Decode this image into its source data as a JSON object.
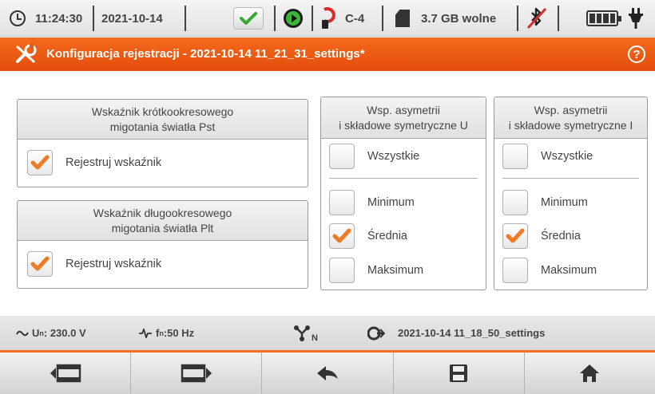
{
  "status": {
    "time": "11:24:30",
    "date": "2021-10-14",
    "clamp": "C-4",
    "storage": "3.7 GB wolne",
    "icons": [
      "clock-icon",
      "ok-check-icon",
      "recording-play-icon",
      "current-clamp-icon",
      "sd-card-icon",
      "bluetooth-off-icon",
      "battery-icon",
      "power-plug-icon"
    ]
  },
  "titlebar": {
    "title": "Konfiguracja rejestracji - 2021-10-14 11_21_31_settings*",
    "help": "?"
  },
  "panels": {
    "pst": {
      "title_line1": "Wskaźnik krótkookresowego",
      "title_line2": "migotania światła Pst",
      "option_label": "Rejestruj wskaźnik",
      "checked": true
    },
    "plt": {
      "title_line1": "Wskaźnik długookresowego",
      "title_line2": "migotania światła Plt",
      "option_label": "Rejestruj wskaźnik",
      "checked": true
    },
    "asym_u": {
      "title_line1": "Wsp. asymetrii",
      "title_line2": "i składowe symetryczne U",
      "options": [
        {
          "label": "Wszystkie",
          "checked": false
        },
        {
          "label": "Minimum",
          "checked": false
        },
        {
          "label": "Średnia",
          "checked": true
        },
        {
          "label": "Maksimum",
          "checked": false
        }
      ]
    },
    "asym_i": {
      "title_line1": "Wsp. asymetrii",
      "title_line2": "i składowe symetryczne I",
      "options": [
        {
          "label": "Wszystkie",
          "checked": false
        },
        {
          "label": "Minimum",
          "checked": false
        },
        {
          "label": "Średnia",
          "checked": true
        },
        {
          "label": "Maksimum",
          "checked": false
        }
      ]
    }
  },
  "info": {
    "voltage_label": "U",
    "voltage_sub": "n",
    "voltage_value": ": 230.0 V",
    "freq_label": "f",
    "freq_sub": "n",
    "freq_value": ":50 Hz",
    "network_sub": "N",
    "settings_file": "2021-10-14 11_18_50_settings"
  },
  "nav": {
    "buttons": [
      "previous-screen",
      "next-screen",
      "back",
      "save",
      "home"
    ]
  },
  "colors": {
    "accent": "#f36f1c",
    "check": "#f07a25"
  }
}
